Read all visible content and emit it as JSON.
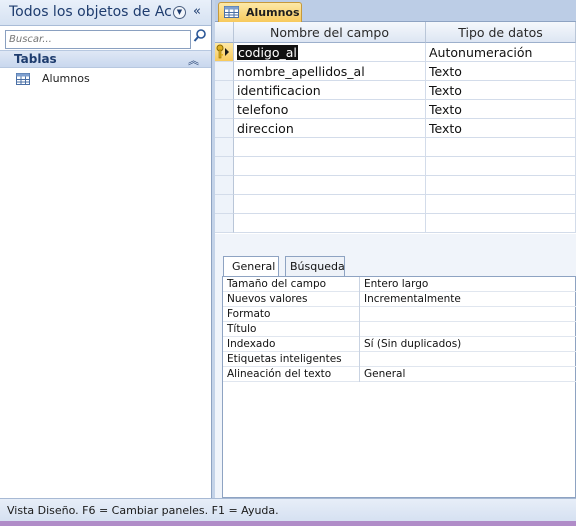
{
  "nav": {
    "title": "Todos los objetos de Acc...",
    "search_placeholder": "Buscar...",
    "group_label": "Tablas",
    "items": [
      {
        "label": "Alumnos",
        "icon": "table-icon"
      }
    ]
  },
  "doc": {
    "tab_label": "Alumnos",
    "columns": {
      "field": "Nombre del campo",
      "type": "Tipo de datos"
    },
    "rows": [
      {
        "field": "codigo_al",
        "type": "Autonumeración",
        "primary_key": true,
        "selected": true
      },
      {
        "field": "nombre_apellidos_al",
        "type": "Texto"
      },
      {
        "field": "identificacion",
        "type": "Texto"
      },
      {
        "field": "telefono",
        "type": "Texto"
      },
      {
        "field": "direccion",
        "type": "Texto"
      }
    ]
  },
  "props": {
    "tabs": [
      "General",
      "Búsqueda"
    ],
    "active_tab": "General",
    "rows": [
      {
        "name": "Tamaño del campo",
        "value": "Entero largo"
      },
      {
        "name": "Nuevos valores",
        "value": "Incrementalmente"
      },
      {
        "name": "Formato",
        "value": ""
      },
      {
        "name": "Título",
        "value": ""
      },
      {
        "name": "Indexado",
        "value": "Sí (Sin duplicados)"
      },
      {
        "name": "Etiquetas inteligentes",
        "value": ""
      },
      {
        "name": "Alineación del texto",
        "value": "General"
      }
    ]
  },
  "status": {
    "text": "Vista Diseño.  F6 = Cambiar paneles.  F1 = Ayuda."
  },
  "colors": {
    "accent": "#f7c95c",
    "nav_header": "#d6e2f2",
    "status_strip": "#b08cc8"
  }
}
